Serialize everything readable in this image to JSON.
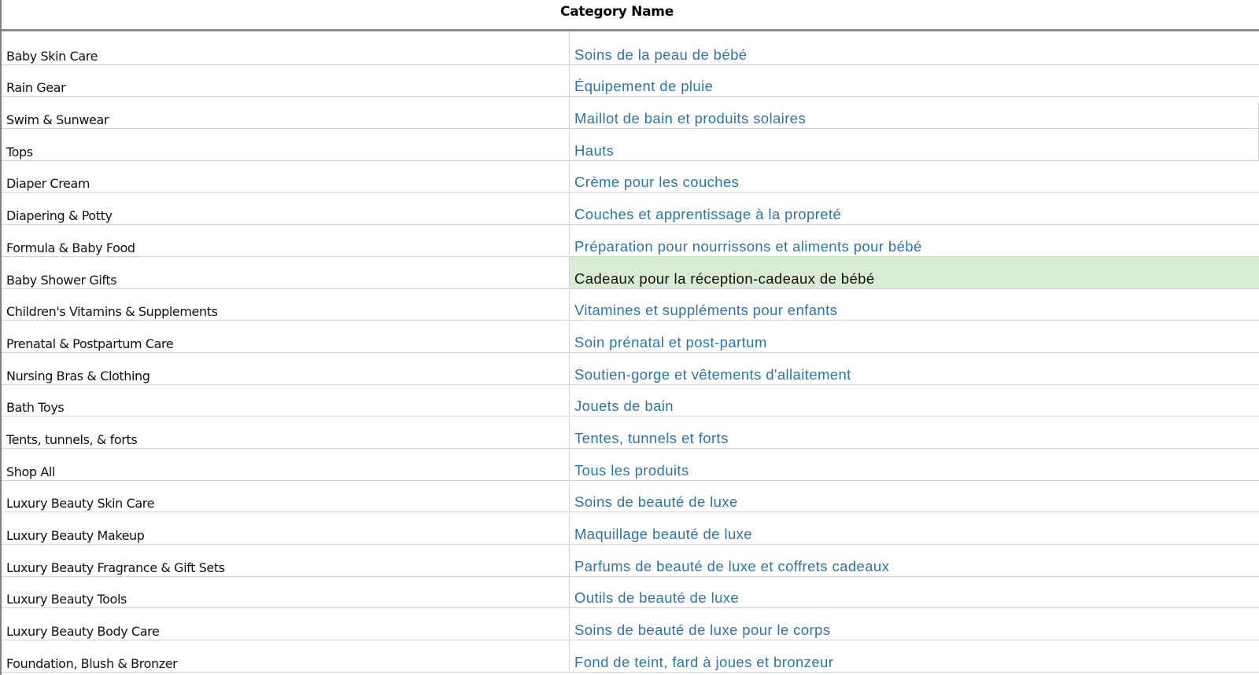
{
  "header": {
    "title": "Category Name"
  },
  "colors": {
    "translation_text": "#2f73a8",
    "highlight_fill": "#d8ecd4",
    "grid_line": "#d4d4d4",
    "header_rule": "#8c8c8c"
  },
  "rows": [
    {
      "en": "Baby Skin Care",
      "fr": "Soins de la peau de bébé",
      "highlighted": false
    },
    {
      "en": "Rain Gear",
      "fr": "Équipement de pluie",
      "highlighted": false
    },
    {
      "en": "Swim & Sunwear",
      "fr": "Maillot de bain et produits solaires",
      "highlighted": false
    },
    {
      "en": "Tops",
      "fr": "Hauts",
      "highlighted": false
    },
    {
      "en": "Diaper Cream",
      "fr": "Crème pour les couches",
      "highlighted": false
    },
    {
      "en": "Diapering & Potty",
      "fr": "Couches et apprentissage à la propreté",
      "highlighted": false
    },
    {
      "en": "Formula & Baby Food",
      "fr": "Préparation pour nourrissons et aliments pour bébé",
      "highlighted": false
    },
    {
      "en": "Baby Shower Gifts",
      "fr": "Cadeaux pour la réception-cadeaux de bébé",
      "highlighted": true
    },
    {
      "en": "Children's Vitamins & Supplements",
      "fr": "Vitamines et suppléments pour enfants",
      "highlighted": false
    },
    {
      "en": "Prenatal & Postpartum Care",
      "fr": "Soin prénatal et post-partum",
      "highlighted": false
    },
    {
      "en": "Nursing Bras & Clothing",
      "fr": "Soutien-gorge et vêtements d'allaitement",
      "highlighted": false
    },
    {
      "en": "Bath Toys",
      "fr": "Jouets de bain",
      "highlighted": false
    },
    {
      "en": "Tents, tunnels, & forts",
      "fr": "Tentes, tunnels et forts",
      "highlighted": false
    },
    {
      "en": "Shop All",
      "fr": "Tous les produits",
      "highlighted": false
    },
    {
      "en": "Luxury Beauty Skin Care",
      "fr": "Soins de beauté de luxe",
      "highlighted": false
    },
    {
      "en": "Luxury Beauty Makeup",
      "fr": "Maquillage beauté de luxe",
      "highlighted": false
    },
    {
      "en": "Luxury Beauty Fragrance & Gift Sets",
      "fr": "Parfums de beauté de luxe et coffrets cadeaux",
      "highlighted": false
    },
    {
      "en": "Luxury Beauty Tools",
      "fr": "Outils de beauté de luxe",
      "highlighted": false
    },
    {
      "en": "Luxury Beauty Body Care",
      "fr": "Soins de beauté de luxe pour le corps",
      "highlighted": false
    },
    {
      "en": "Foundation, Blush & Bronzer",
      "fr": "Fond de teint, fard à joues et bronzeur",
      "highlighted": false
    }
  ]
}
